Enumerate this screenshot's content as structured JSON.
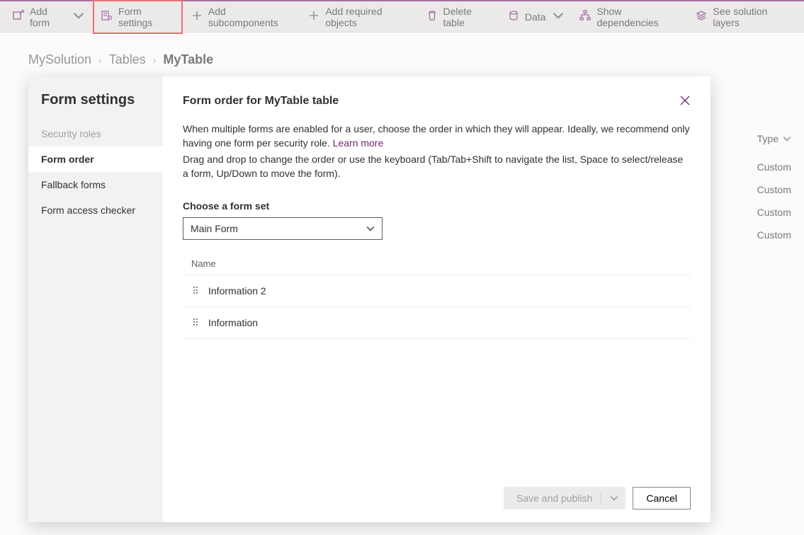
{
  "toolbar": {
    "add_form": "Add form",
    "form_settings": "Form settings",
    "add_subcomponents": "Add subcomponents",
    "add_required_objects": "Add required objects",
    "delete_table": "Delete table",
    "data": "Data",
    "show_dependencies": "Show dependencies",
    "see_solution_layers": "See solution layers"
  },
  "breadcrumb": {
    "root": "MySolution",
    "mid": "Tables",
    "leaf": "MyTable"
  },
  "background_column": {
    "header": "Type",
    "cells": [
      "Custom",
      "Custom",
      "Custom",
      "Custom"
    ]
  },
  "panel": {
    "title": "Form settings",
    "nav": {
      "security_roles": "Security roles",
      "form_order": "Form order",
      "fallback_forms": "Fallback forms",
      "form_access_checker": "Form access checker"
    },
    "main": {
      "heading": "Form order for MyTable table",
      "para1_left": "When multiple forms are enabled for a user, choose the order in which they will appear. Ideally, we recommend only having one form per security role. ",
      "learn_more": "Learn more",
      "para2": "Drag and drop to change the order or use the keyboard (Tab/Tab+Shift to navigate the list, Space to select/release a form, Up/Down to move the form).",
      "choose_label": "Choose a form set",
      "form_set_value": "Main Form",
      "list_header": "Name",
      "rows": [
        "Information 2",
        "Information"
      ]
    },
    "footer": {
      "save_publish": "Save and publish",
      "cancel": "Cancel"
    }
  }
}
